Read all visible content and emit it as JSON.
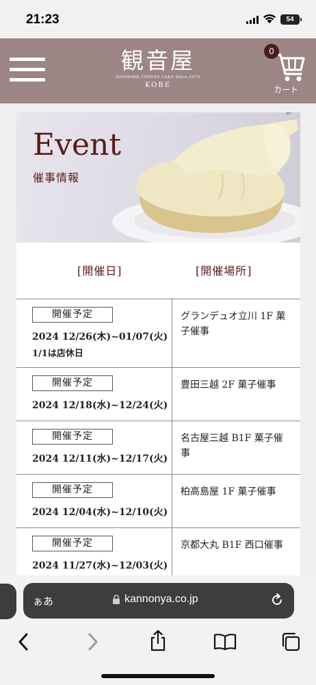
{
  "status": {
    "time": "21:23",
    "battery": "54"
  },
  "header": {
    "logo_main": "観音屋",
    "logo_sub": "DENMARK CHEESE CAKE Since 1975",
    "logo_city": "KOBE",
    "cart_count": "0",
    "cart_label": "カート"
  },
  "hero": {
    "title": "Event",
    "subtitle": "催事情報"
  },
  "columns": {
    "date": "[開催日]",
    "place": "[開催場所]"
  },
  "events": [
    {
      "status": "開催予定",
      "date": "2024  12/26(木)~01/07(火)",
      "note": "1/1は店休日",
      "place": "グランデュオ立川 1F 菓子催事"
    },
    {
      "status": "開催予定",
      "date": "2024  12/18(水)~12/24(火)",
      "note": "",
      "place": "豊田三越 2F 菓子催事"
    },
    {
      "status": "開催予定",
      "date": "2024  12/11(水)~12/17(火)",
      "note": "",
      "place": "名古屋三越 B1F 菓子催事"
    },
    {
      "status": "開催予定",
      "date": "2024  12/04(水)~12/10(火)",
      "note": "",
      "place": "柏高島屋 1F 菓子催事"
    },
    {
      "status": "開催予定",
      "date": "2024  11/27(水)~12/03(火)",
      "note": "",
      "place": "京都大丸 B1F 西口催事"
    }
  ],
  "browser": {
    "aa_label": "ぁあ",
    "url": "kannonya.co.jp"
  },
  "icons": [
    "hamburger-icon",
    "cart-icon",
    "lock-icon",
    "reload-icon",
    "back-icon",
    "forward-icon",
    "share-icon",
    "bookmarks-icon",
    "tabs-icon"
  ]
}
